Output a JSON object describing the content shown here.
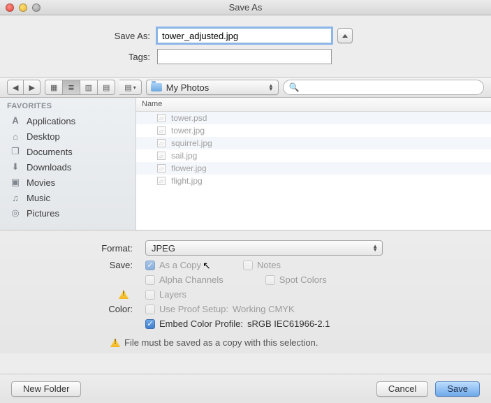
{
  "window": {
    "title": "Save As"
  },
  "saveas": {
    "label": "Save As:",
    "value": "tower_adjusted.jpg",
    "tags_label": "Tags:",
    "tags_value": ""
  },
  "path": {
    "folder": "My Photos"
  },
  "search": {
    "placeholder": ""
  },
  "sidebar": {
    "heading": "FAVORITES",
    "items": [
      {
        "label": "Applications",
        "glyph": "𝐀"
      },
      {
        "label": "Desktop",
        "glyph": "⌂"
      },
      {
        "label": "Documents",
        "glyph": "❐"
      },
      {
        "label": "Downloads",
        "glyph": "⬇"
      },
      {
        "label": "Movies",
        "glyph": "▣"
      },
      {
        "label": "Music",
        "glyph": "♫"
      },
      {
        "label": "Pictures",
        "glyph": "◎"
      }
    ]
  },
  "files": {
    "column_header": "Name",
    "rows": [
      "tower.psd",
      "tower.jpg",
      "squirrel.jpg",
      "sail.jpg",
      "flower.jpg",
      "flight.jpg"
    ]
  },
  "format": {
    "label": "Format:",
    "value": "JPEG"
  },
  "save": {
    "label": "Save:",
    "as_copy": "As a Copy",
    "notes": "Notes",
    "alpha": "Alpha Channels",
    "spot": "Spot Colors",
    "layers": "Layers"
  },
  "color": {
    "label": "Color:",
    "proof": "Use Proof Setup:",
    "proof_value": "Working CMYK",
    "embed": "Embed Color Profile:",
    "embed_value": "sRGB IEC61966-2.1"
  },
  "message": "File must be saved as a copy with this selection.",
  "buttons": {
    "new_folder": "New Folder",
    "cancel": "Cancel",
    "save": "Save"
  }
}
